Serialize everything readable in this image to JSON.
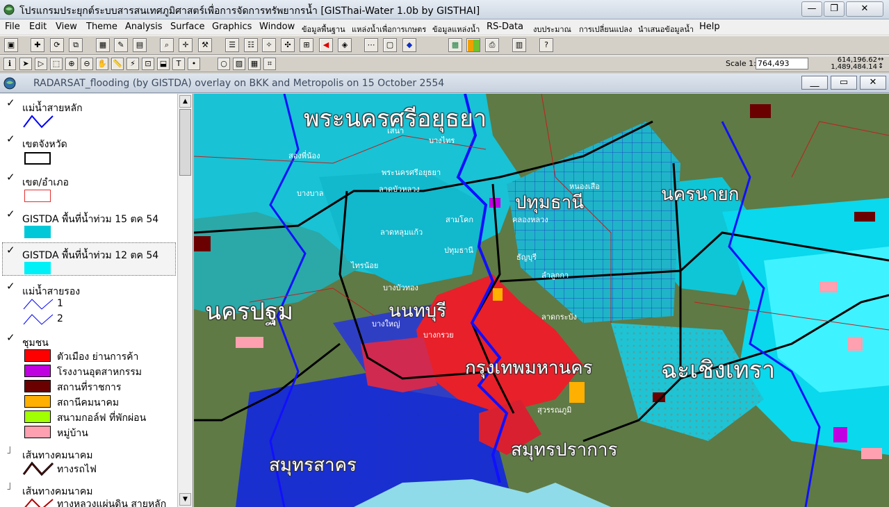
{
  "window": {
    "title": "โปรแกรมประยุกต์ระบบสารสนเทศภูมิศาสตร์เพื่อการจัดการทรัพยากรน้ำ   [GISThai-Water 1.0b   by GISTHAI]",
    "minimize": "—",
    "restore": "❐",
    "close": "✕"
  },
  "menu": [
    "File",
    "Edit",
    "View",
    "Theme",
    "Analysis",
    "Surface",
    "Graphics",
    "Window",
    "ข้อมูลพื้นฐาน",
    "แหล่งน้ำเพื่อการเกษตร",
    "ข้อมูลแหล่งน้ำ",
    "RS-Data",
    "งบประมาณ",
    "การเปลี่ยนแปลง",
    "นำเสนอข้อมูลน้ำ",
    "Help"
  ],
  "scale": {
    "label": "Scale 1:",
    "value": "764,493"
  },
  "coords": {
    "x": "614,196.62",
    "y": "1,489,484.14",
    "arrows_x": "↔",
    "arrows_y": "↕"
  },
  "document": {
    "title": "RADARSAT_flooding (by GISTDA) overlay on BKK and Metropolis on 15 October 2554",
    "minimize": "__",
    "restore": "▭",
    "close": "✕"
  },
  "legend": {
    "themes": [
      {
        "name": "แม่น้ำสายหลัก",
        "checked": true
      },
      {
        "name": "เขตจังหวัด",
        "checked": true
      },
      {
        "name": "เขต/อำเภอ",
        "checked": true
      },
      {
        "name": "GISTDA พื้นที่น้ำท่วม 15 ตค 54",
        "checked": true,
        "color": "#00c8d8"
      },
      {
        "name": "GISTDA พื้นที่น้ำท่วม 12 ตค 54",
        "checked": true,
        "color": "#00f0f8"
      },
      {
        "name": "แม่น้ำสายรอง",
        "checked": true,
        "classes": [
          "1",
          "2"
        ]
      },
      {
        "name": "ชุมชน",
        "checked": true
      },
      {
        "name": "เส้นทางคมนาคม",
        "checked": false,
        "sub": "ทางรถไฟ"
      },
      {
        "name": "เส้นทางคมนาคม",
        "checked": false,
        "sub": "ทางหลวงแผ่นดิน สายหลัก"
      }
    ],
    "community": [
      {
        "label": "ตัวเมือง ย่านการค้า",
        "color": "#ff0000"
      },
      {
        "label": "โรงงานอุตสาหกรรม",
        "color": "#c000e0"
      },
      {
        "label": "สถานที่ราชการ",
        "color": "#6b0000"
      },
      {
        "label": "สถานีคมนาคม",
        "color": "#ffb000"
      },
      {
        "label": "สนามกอล์ฟ ที่พักผ่อน",
        "color": "#a0ff00"
      },
      {
        "label": "หมู่บ้าน",
        "color": "#ffa0b0"
      }
    ]
  },
  "map": {
    "provinces": [
      "พระนครศรีอยุธยา",
      "ปทุมธานี",
      "นครนายก",
      "นครปฐม",
      "นนทบุรี",
      "กรุงเทพมหานคร",
      "ฉะเชิงเทรา",
      "สมุทรสาคร",
      "สมุทรปราการ"
    ],
    "districts": [
      "เสนา",
      "บางไทร",
      "สองพี่น้อง",
      "พระนครศรีอยุธยา",
      "บางบาล",
      "ลาดบัวหลวง",
      "คลองหลวง",
      "หนองเสือ",
      "ลาดหลุมแก้ว",
      "ปทุมธานี",
      "สามโคก",
      "ธัญบุรี",
      "ลำลูกกา",
      "ไทรน้อย",
      "บางบัวทอง",
      "บางใหญ่",
      "บางกรวย",
      "ลาดกระบัง",
      "สุวรรณภูมิ"
    ]
  }
}
